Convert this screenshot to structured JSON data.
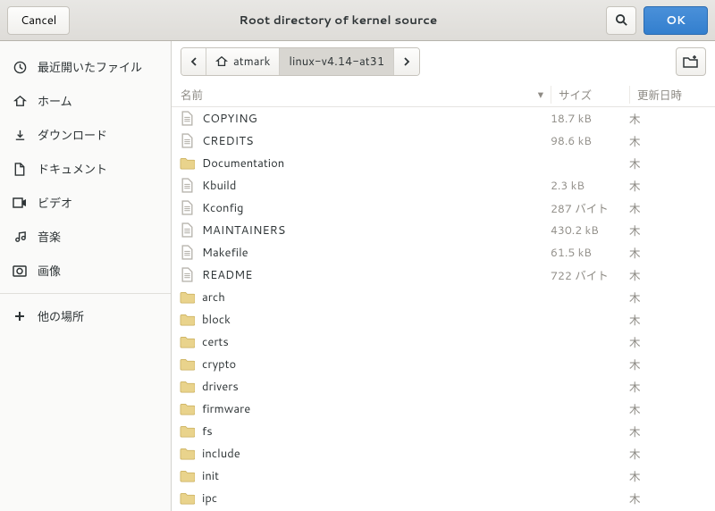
{
  "titlebar": {
    "cancel": "Cancel",
    "title": "Root directory of kernel source",
    "ok": "OK"
  },
  "sidebar": {
    "items": [
      {
        "icon": "clock",
        "label": "最近開いたファイル"
      },
      {
        "icon": "home",
        "label": "ホーム"
      },
      {
        "icon": "download",
        "label": "ダウンロード"
      },
      {
        "icon": "document",
        "label": "ドキュメント"
      },
      {
        "icon": "video",
        "label": "ビデオ"
      },
      {
        "icon": "music",
        "label": "音楽"
      },
      {
        "icon": "picture",
        "label": "画像"
      }
    ],
    "other_places": {
      "icon": "plus",
      "label": "他の場所"
    }
  },
  "pathbar": {
    "segments": [
      {
        "icon": "home",
        "label": "atmark"
      },
      {
        "label": "linux-v4.14-at31",
        "active": true
      }
    ]
  },
  "columns": {
    "name": "名前",
    "size": "サイズ",
    "date": "更新日時"
  },
  "files": [
    {
      "type": "file",
      "name": "COPYING",
      "size": "18.7 kB",
      "date": "木"
    },
    {
      "type": "file",
      "name": "CREDITS",
      "size": "98.6 kB",
      "date": "木"
    },
    {
      "type": "folder",
      "name": "Documentation",
      "size": "",
      "date": "木"
    },
    {
      "type": "file",
      "name": "Kbuild",
      "size": "2.3 kB",
      "date": "木"
    },
    {
      "type": "file",
      "name": "Kconfig",
      "size": "287 バイト",
      "date": "木"
    },
    {
      "type": "file",
      "name": "MAINTAINERS",
      "size": "430.2 kB",
      "date": "木"
    },
    {
      "type": "file",
      "name": "Makefile",
      "size": "61.5 kB",
      "date": "木"
    },
    {
      "type": "file",
      "name": "README",
      "size": "722 バイト",
      "date": "木"
    },
    {
      "type": "folder",
      "name": "arch",
      "size": "",
      "date": "木"
    },
    {
      "type": "folder",
      "name": "block",
      "size": "",
      "date": "木"
    },
    {
      "type": "folder",
      "name": "certs",
      "size": "",
      "date": "木"
    },
    {
      "type": "folder",
      "name": "crypto",
      "size": "",
      "date": "木"
    },
    {
      "type": "folder",
      "name": "drivers",
      "size": "",
      "date": "木"
    },
    {
      "type": "folder",
      "name": "firmware",
      "size": "",
      "date": "木"
    },
    {
      "type": "folder",
      "name": "fs",
      "size": "",
      "date": "木"
    },
    {
      "type": "folder",
      "name": "include",
      "size": "",
      "date": "木"
    },
    {
      "type": "folder",
      "name": "init",
      "size": "",
      "date": "木"
    },
    {
      "type": "folder",
      "name": "ipc",
      "size": "",
      "date": "木"
    }
  ]
}
